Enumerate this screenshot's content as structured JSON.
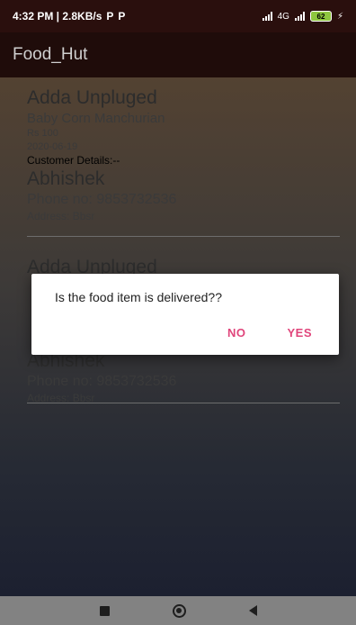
{
  "status_bar": {
    "time_speed": "4:32 PM | 2.8KB/s",
    "notif_icon_1": "P",
    "notif_icon_2": "P",
    "network_badge": "4G",
    "battery": "62",
    "charging": "⚡"
  },
  "app_bar": {
    "title": "Food_Hut"
  },
  "orders": [
    {
      "shop": "Adda Unpluged",
      "item": "Baby Corn Manchurian",
      "price": "Rs 100",
      "date": "2020-06-19",
      "customer_label": "Customer Details:--",
      "customer_name": "Abhishek",
      "phone": "Phone no: 9853732536",
      "address": "Address: Bbsr"
    },
    {
      "shop": "Adda Unpluged",
      "customer_name": "Abhishek",
      "phone": "Phone no: 9853732536",
      "address": "Address: Bbsr"
    }
  ],
  "dialog": {
    "message": "Is the food item is delivered??",
    "no_label": "NO",
    "yes_label": "YES"
  },
  "colors": {
    "accent": "#e0457b",
    "app_bar": "#1f0c0a",
    "nav_bar": "#828282"
  },
  "icons": {
    "nav_recents": "square-icon",
    "nav_home": "circle-icon",
    "nav_back": "back-triangle-icon"
  }
}
